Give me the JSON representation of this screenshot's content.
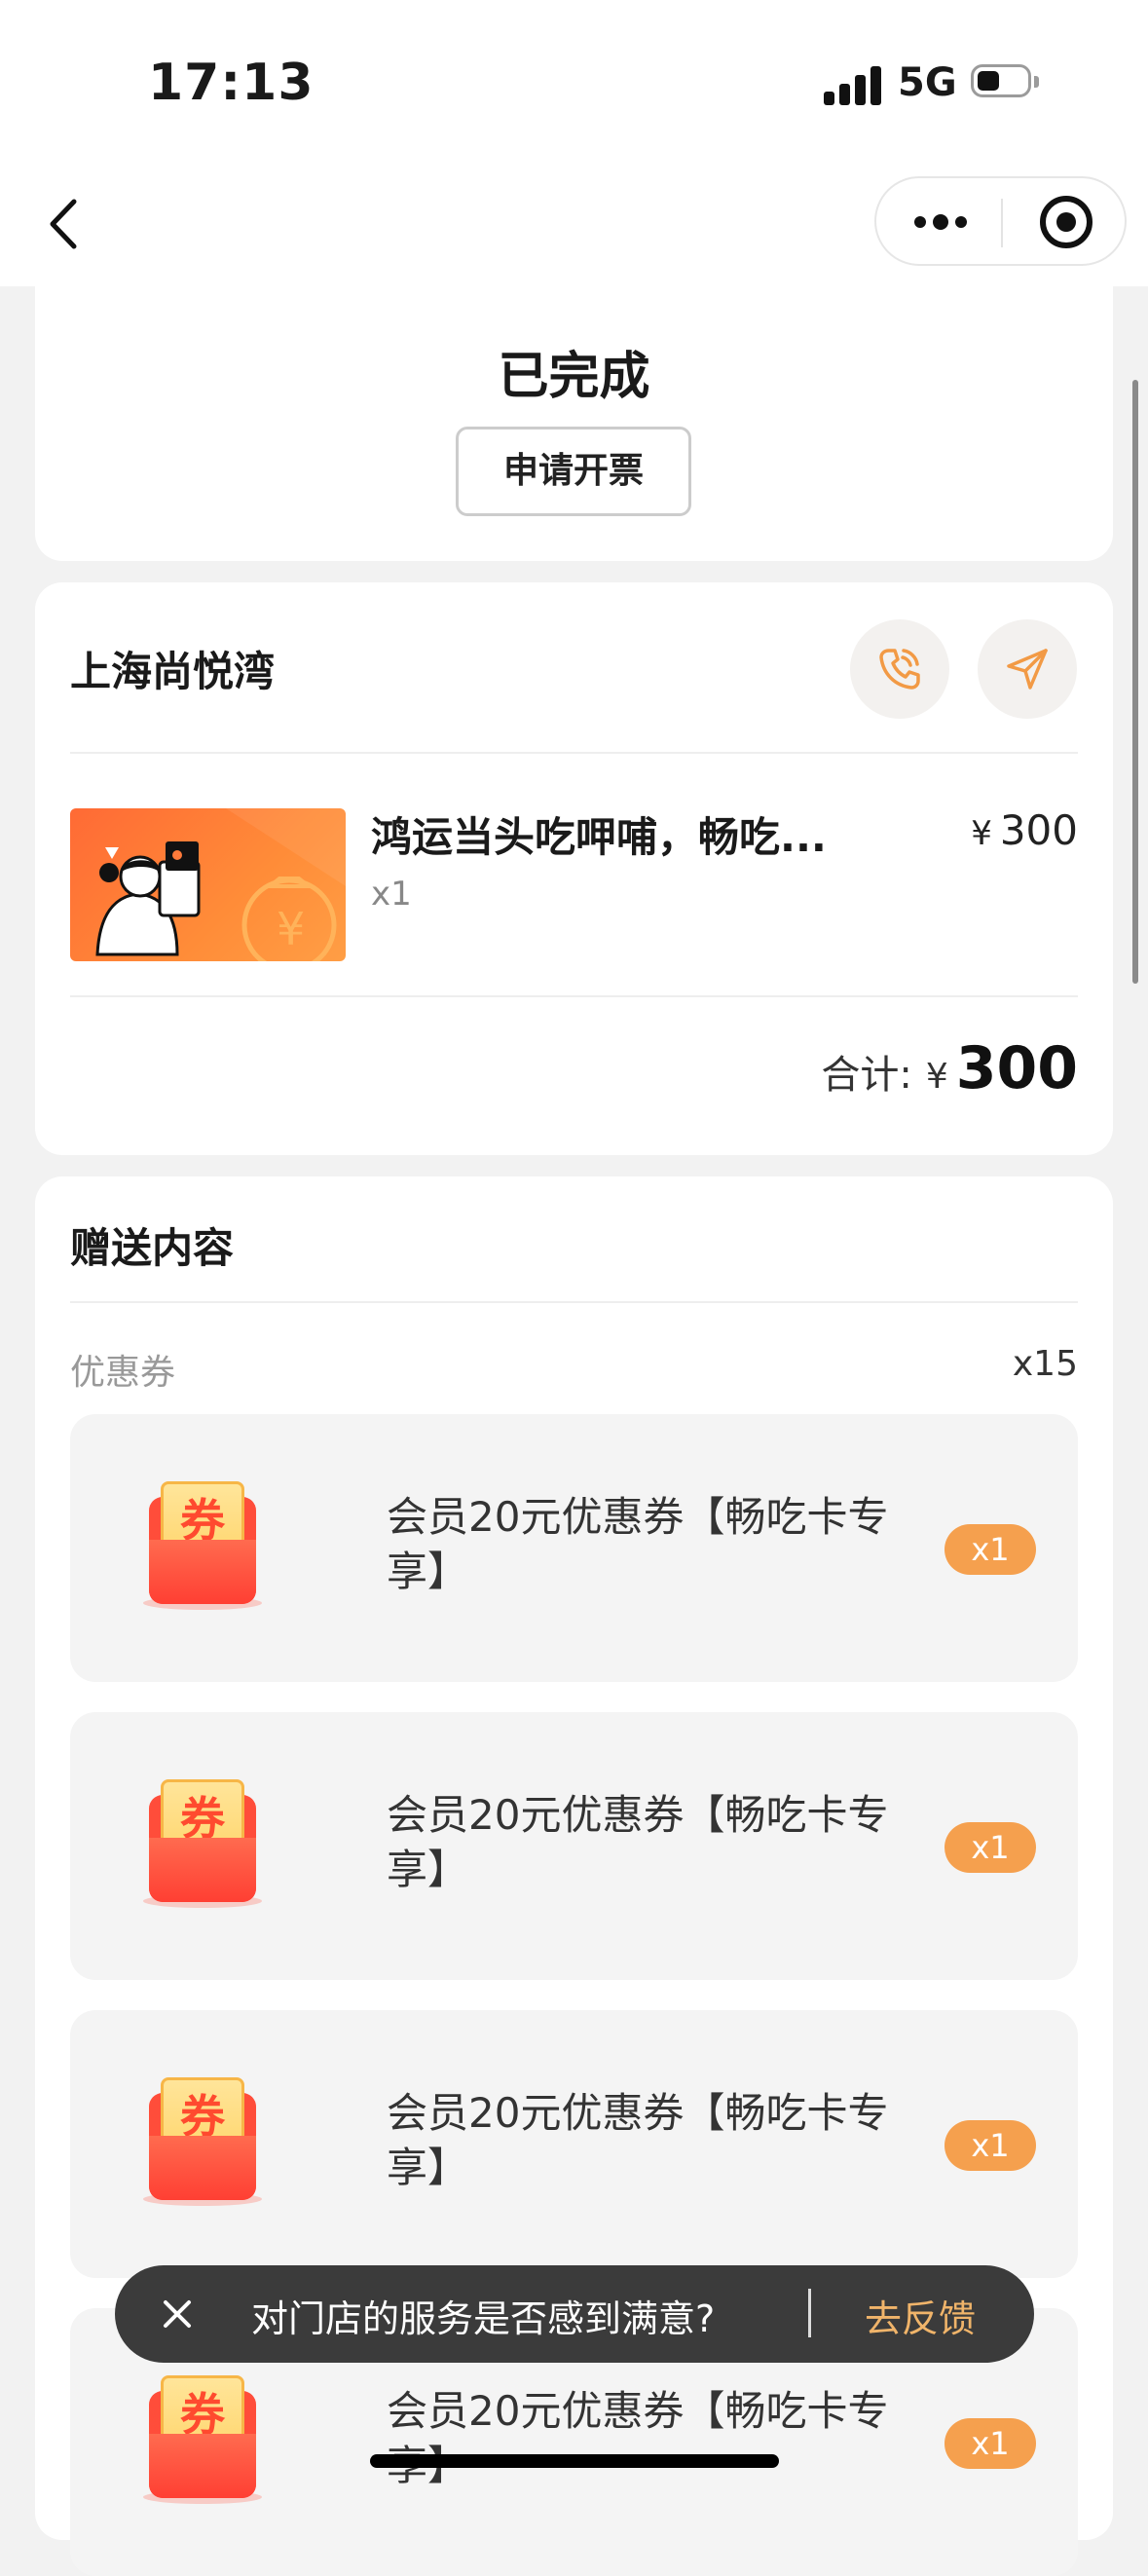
{
  "status_bar": {
    "time": "17:13",
    "network": "5G"
  },
  "nav": {
    "back_icon": "chevron-left-icon",
    "more_icon": "more-dots-icon",
    "target_icon": "target-icon"
  },
  "order_status": {
    "title": "已完成",
    "invoice_button": "申请开票"
  },
  "store": {
    "name": "上海尚悦湾",
    "phone_icon": "phone-icon",
    "navigate_icon": "navigate-arrow-icon",
    "product": {
      "name": "鸿运当头吃呷哺，畅吃...",
      "qty": "x1",
      "currency": "¥",
      "price": "300"
    },
    "total": {
      "label": "合计:",
      "currency": "¥",
      "amount": "300"
    }
  },
  "gift": {
    "title": "赠送内容",
    "coupon_section": {
      "label": "优惠券",
      "count": "x15"
    },
    "coupons": [
      {
        "icon_char": "券",
        "text": "会员20元优惠券【畅吃卡专享】",
        "qty": "x1"
      },
      {
        "icon_char": "券",
        "text": "会员20元优惠券【畅吃卡专享】",
        "qty": "x1"
      },
      {
        "icon_char": "券",
        "text": "会员20元优惠券【畅吃卡专享】",
        "qty": "x1"
      },
      {
        "icon_char": "券",
        "text": "会员20元优惠券【畅吃卡专享】",
        "qty": "x1"
      }
    ]
  },
  "feedback_toast": {
    "message": "对门店的服务是否感到满意?",
    "action": "去反馈"
  },
  "colors": {
    "accent_orange": "#f5a04e",
    "toast_bg": "#3b3b3b",
    "toast_link": "#f0b46a",
    "page_bg": "#f2f2f2"
  }
}
